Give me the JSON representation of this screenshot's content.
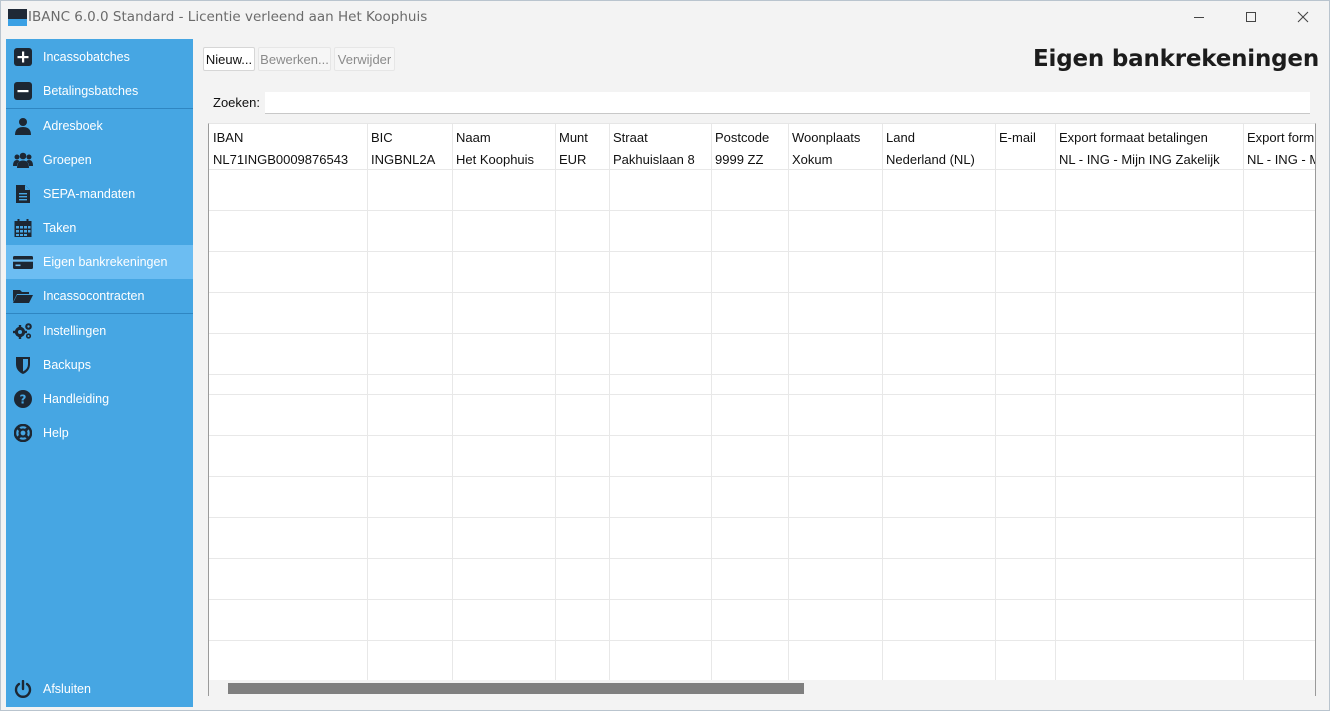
{
  "window": {
    "title": "IBANC 6.0.0 Standard - Licentie verleend aan Het Koophuis"
  },
  "sidebar": {
    "items": [
      {
        "label": "Incassobatches",
        "icon": "plus-square-icon"
      },
      {
        "label": "Betalingsbatches",
        "icon": "minus-square-icon"
      },
      {
        "label": "Adresboek",
        "icon": "person-icon"
      },
      {
        "label": "Groepen",
        "icon": "group-icon"
      },
      {
        "label": "SEPA-mandaten",
        "icon": "document-icon"
      },
      {
        "label": "Taken",
        "icon": "calendar-icon"
      },
      {
        "label": "Eigen bankrekeningen",
        "icon": "credit-card-icon",
        "active": true
      },
      {
        "label": "Incassocontracten",
        "icon": "folder-open-icon"
      },
      {
        "label": "Instellingen",
        "icon": "gears-icon"
      },
      {
        "label": "Backups",
        "icon": "shield-icon"
      },
      {
        "label": "Handleiding",
        "icon": "question-circle-icon"
      },
      {
        "label": "Help",
        "icon": "lifebuoy-icon"
      }
    ],
    "exit_label": "Afsluiten",
    "exit_icon": "power-icon"
  },
  "toolbar": {
    "new_label": "Nieuw...",
    "edit_label": "Bewerken...",
    "delete_label": "Verwijder"
  },
  "page": {
    "title": "Eigen bankrekeningen"
  },
  "search": {
    "label": "Zoeken:",
    "value": ""
  },
  "table": {
    "columns": [
      "IBAN",
      "BIC",
      "Naam",
      "Munt",
      "Straat",
      "Postcode",
      "Woonplaats",
      "Land",
      "E-mail",
      "Export formaat betalingen",
      "Export form"
    ],
    "rows": [
      [
        "NL71INGB0009876543",
        "INGBNL2A",
        "Het Koophuis",
        "EUR",
        "Pakhuislaan 8",
        "9999 ZZ",
        "Xokum",
        "Nederland (NL)",
        "",
        "NL - ING - Mijn ING Zakelijk",
        "NL - ING - M"
      ]
    ]
  },
  "colors": {
    "sidebar_bg": "#46a6e3",
    "sidebar_active": "#6cbdf2",
    "scrollbar_thumb": "#7f7f7f"
  }
}
